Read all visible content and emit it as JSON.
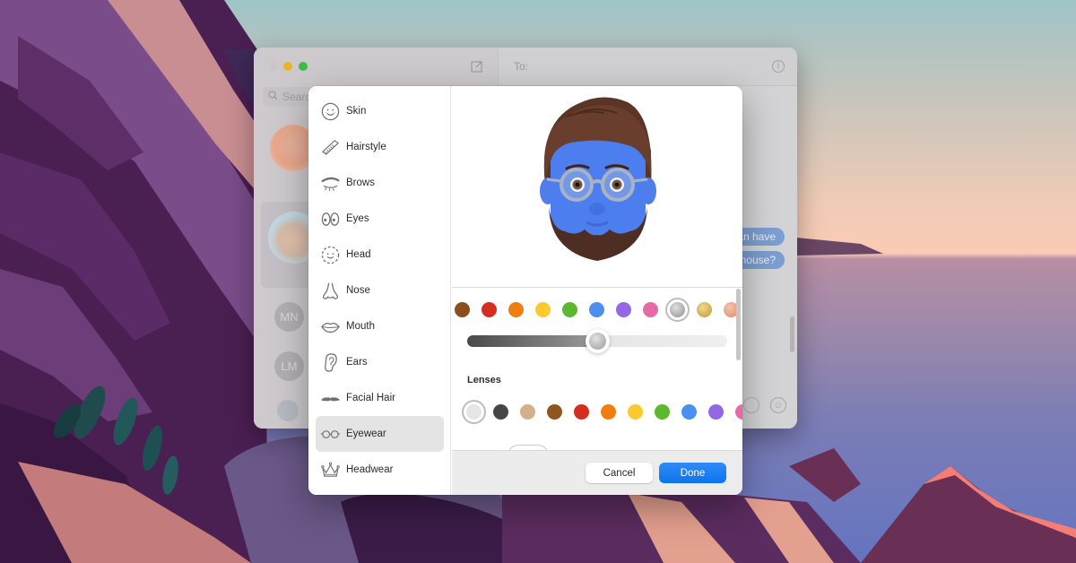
{
  "messages_window": {
    "search_placeholder": "Search",
    "to_label": "To:",
    "conversations": [
      {
        "initials": "",
        "type": "memoji-avatar"
      },
      {
        "initials": "",
        "type": "memoji-avatar",
        "selected": true
      },
      {
        "initials": "MN",
        "type": "initials"
      },
      {
        "initials": "LM",
        "type": "initials"
      }
    ],
    "bubbles": [
      "an have",
      "mouse?"
    ]
  },
  "memoji_editor": {
    "categories": [
      {
        "label": "Skin",
        "icon": "face-freckles-icon"
      },
      {
        "label": "Hairstyle",
        "icon": "comb-icon"
      },
      {
        "label": "Brows",
        "icon": "brow-icon"
      },
      {
        "label": "Eyes",
        "icon": "eyes-icon"
      },
      {
        "label": "Head",
        "icon": "head-outline-icon"
      },
      {
        "label": "Nose",
        "icon": "nose-icon"
      },
      {
        "label": "Mouth",
        "icon": "lips-icon"
      },
      {
        "label": "Ears",
        "icon": "ear-icon"
      },
      {
        "label": "Facial Hair",
        "icon": "mustache-icon"
      },
      {
        "label": "Eyewear",
        "icon": "glasses-icon",
        "selected": true
      },
      {
        "label": "Headwear",
        "icon": "crown-icon"
      }
    ],
    "frame_colors": [
      "#8b4f1d",
      "#d42e1f",
      "#ef7d12",
      "#fcc92e",
      "#5cb82f",
      "#4b8ff1",
      "#9566e6",
      "#e66aa6",
      "#b0b0b0",
      "#d8b25a",
      "#e9a58c"
    ],
    "frame_color_selected_index": 8,
    "frame_shade_value": 0.5,
    "lenses_title": "Lenses",
    "lens_colors": [
      "#e6e6e6",
      "#464646",
      "#d4b08a",
      "#8f561d",
      "#d42e1f",
      "#ef7d12",
      "#fcc92e",
      "#5cb82f",
      "#4b8ff1",
      "#9566e6",
      "#e66aa6"
    ],
    "lens_color_selected_index": 0,
    "cancel_label": "Cancel",
    "done_label": "Done"
  }
}
